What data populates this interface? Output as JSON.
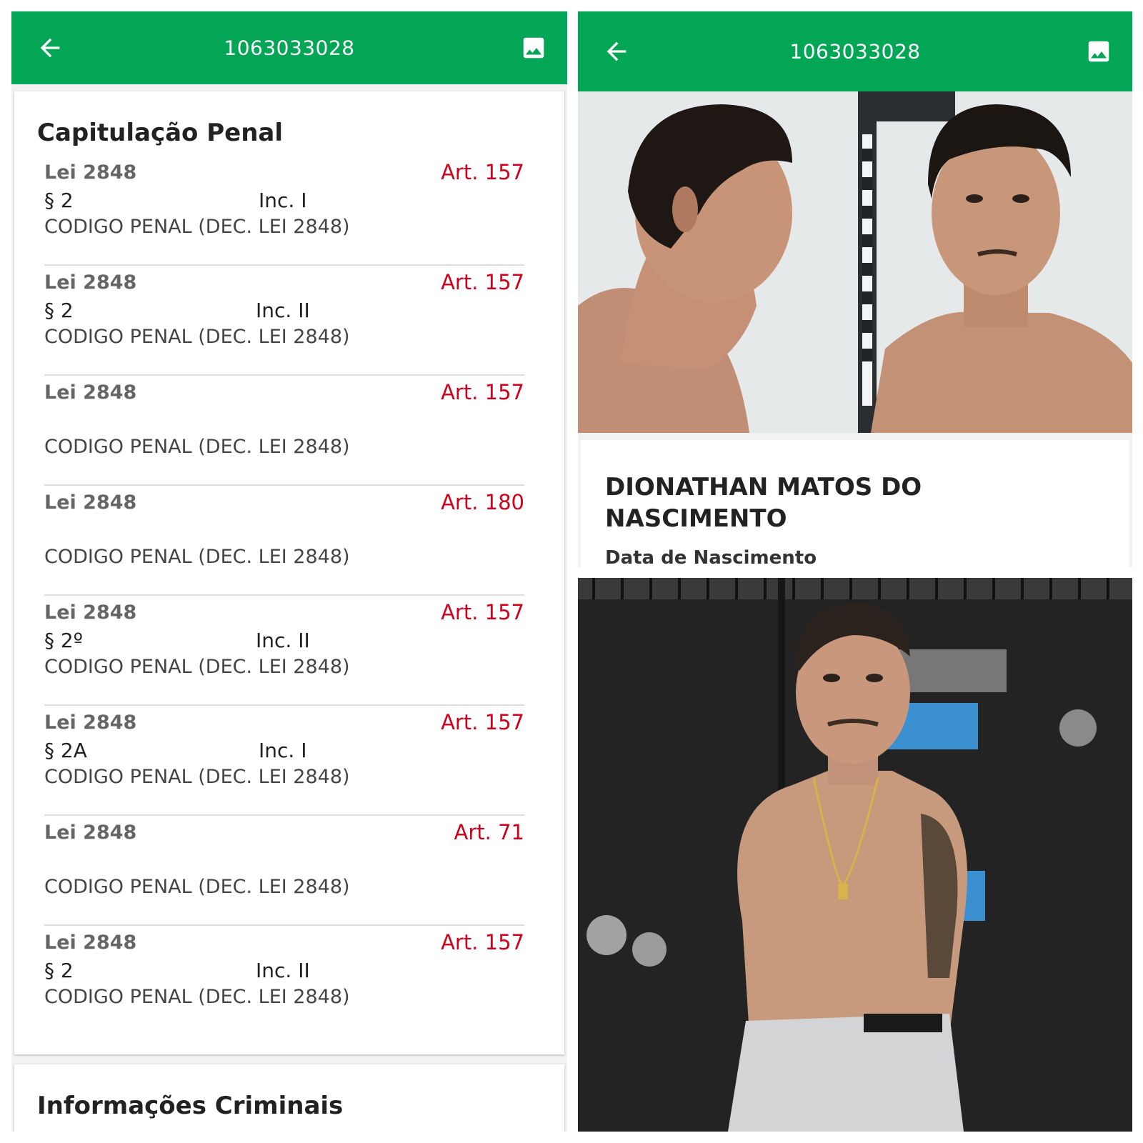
{
  "left_screen": {
    "appbar": {
      "title": "1063033028"
    },
    "capitulacao": {
      "title": "Capitulação Penal",
      "entries": [
        {
          "lei": "Lei 2848",
          "art": "Art. 157",
          "paragrafo": "§ 2",
          "inciso": "Inc. I",
          "codigo": "CODIGO PENAL (DEC. LEI 2848)"
        },
        {
          "lei": "Lei 2848",
          "art": "Art. 157",
          "paragrafo": "§ 2",
          "inciso": "Inc. II",
          "codigo": "CODIGO PENAL (DEC. LEI 2848)"
        },
        {
          "lei": "Lei 2848",
          "art": "Art. 157",
          "paragrafo": "",
          "inciso": "",
          "codigo": "CODIGO PENAL (DEC. LEI 2848)"
        },
        {
          "lei": "Lei 2848",
          "art": "Art. 180",
          "paragrafo": "",
          "inciso": "",
          "codigo": "CODIGO PENAL (DEC. LEI 2848)"
        },
        {
          "lei": "Lei 2848",
          "art": "Art. 157",
          "paragrafo": "§ 2º",
          "inciso": "Inc. II",
          "codigo": "CODIGO PENAL (DEC. LEI 2848)"
        },
        {
          "lei": "Lei 2848",
          "art": "Art. 157",
          "paragrafo": "§ 2A",
          "inciso": "Inc. I",
          "codigo": "CODIGO PENAL (DEC. LEI 2848)"
        },
        {
          "lei": "Lei 2848",
          "art": "Art. 71",
          "paragrafo": "",
          "inciso": "",
          "codigo": "CODIGO PENAL (DEC. LEI 2848)"
        },
        {
          "lei": "Lei 2848",
          "art": "Art. 157",
          "paragrafo": "§ 2",
          "inciso": "Inc. II",
          "codigo": "CODIGO PENAL (DEC. LEI 2848)"
        }
      ]
    },
    "info_title": "Informações Criminais"
  },
  "right_screen": {
    "appbar": {
      "title": "1063033028"
    },
    "person": {
      "name": "DIONATHAN MATOS DO NASCIMENTO",
      "dob_label": "Data de Nascimento"
    }
  },
  "colors": {
    "appbar": "#02a654",
    "article": "#d0021b"
  },
  "icons": {
    "back": "arrow-left-icon",
    "image": "image-icon"
  }
}
